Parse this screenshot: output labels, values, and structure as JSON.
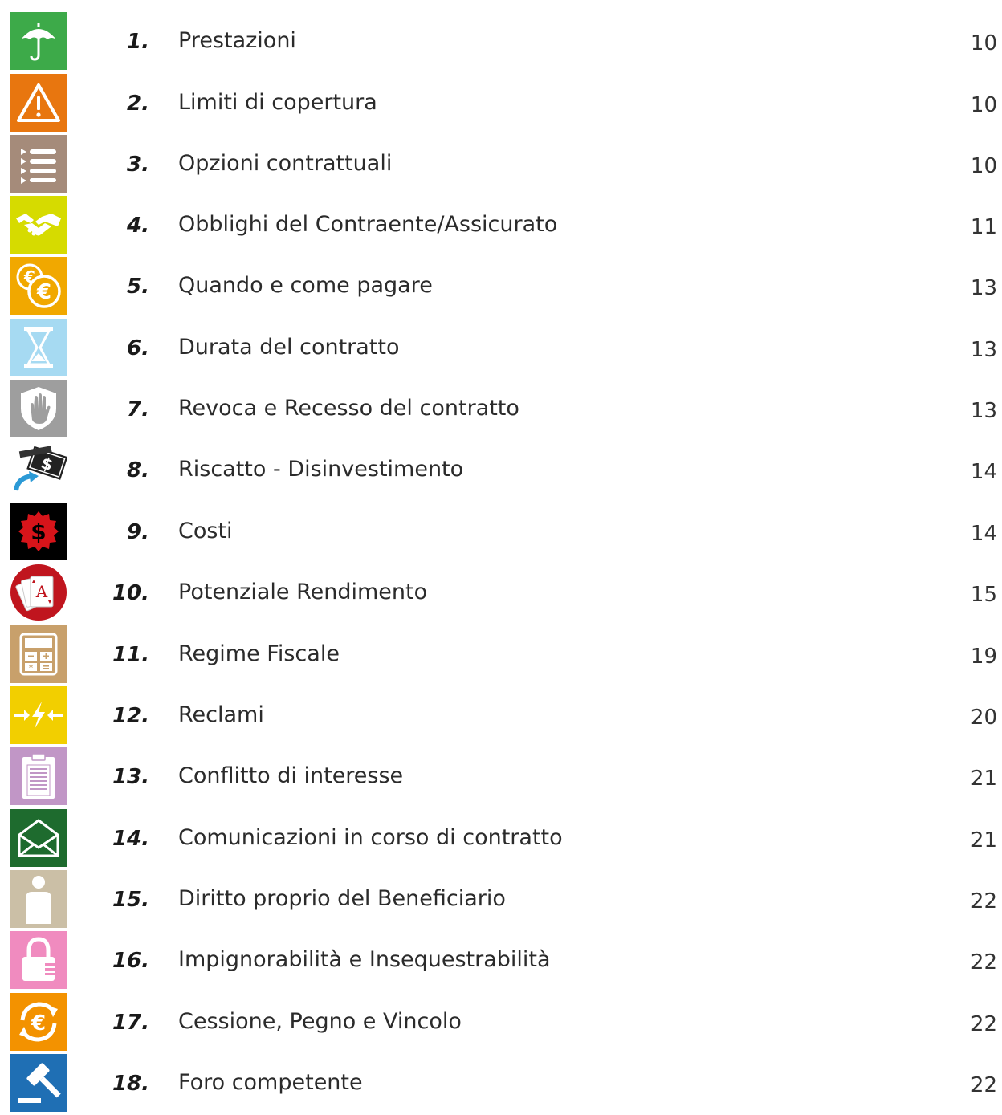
{
  "toc": [
    {
      "number": "1.",
      "title": "Prestazioni",
      "page": "10",
      "icon": "umbrella-icon",
      "color": "#3DAA49"
    },
    {
      "number": "2.",
      "title": "Limiti di copertura",
      "page": "10",
      "icon": "warning-icon",
      "color": "#E8760F"
    },
    {
      "number": "3.",
      "title": "Opzioni contrattuali",
      "page": "10",
      "icon": "list-icon",
      "color": "#A58B7A"
    },
    {
      "number": "4.",
      "title": "Obblighi del Contraente/Assicurato",
      "page": "11",
      "icon": "handshake-icon",
      "color": "#D6DB00"
    },
    {
      "number": "5.",
      "title": "Quando e come pagare",
      "page": "13",
      "icon": "euro-coins-icon",
      "color": "#F1A800"
    },
    {
      "number": "6.",
      "title": "Durata del contratto",
      "page": "13",
      "icon": "hourglass-icon",
      "color": "#A6DAF2"
    },
    {
      "number": "7.",
      "title": "Revoca e Recesso del contratto",
      "page": "13",
      "icon": "shield-hand-icon",
      "color": "#9E9E9E"
    },
    {
      "number": "8.",
      "title": "Riscatto - Disinvestimento",
      "page": "14",
      "icon": "money-return-icon",
      "color": "#FFFFFF"
    },
    {
      "number": "9.",
      "title": "Costi",
      "page": "14",
      "icon": "dollar-badge-icon",
      "color": "#000000"
    },
    {
      "number": "10.",
      "title": "Potenziale Rendimento",
      "page": "15",
      "icon": "playing-cards-icon",
      "color": "#C0151E"
    },
    {
      "number": "11.",
      "title": "Regime Fiscale",
      "page": "19",
      "icon": "calculator-icon",
      "color": "#C8A06B"
    },
    {
      "number": "12.",
      "title": "Reclami",
      "page": "20",
      "icon": "conflict-arrows-icon",
      "color": "#F2CF00"
    },
    {
      "number": "13.",
      "title": "Conflitto di interesse",
      "page": "21",
      "icon": "clipboard-icon",
      "color": "#C196C6"
    },
    {
      "number": "14.",
      "title": "Comunicazioni in corso di contratto",
      "page": "21",
      "icon": "envelope-icon",
      "color": "#1E6B2E"
    },
    {
      "number": "15.",
      "title": "Diritto proprio del Beneficiario",
      "page": "22",
      "icon": "person-icon",
      "color": "#CBBFA6"
    },
    {
      "number": "16.",
      "title": "Impignorabilità e Insequestrabilità",
      "page": "22",
      "icon": "padlock-icon",
      "color": "#F08BBF"
    },
    {
      "number": "17.",
      "title": "Cessione, Pegno e Vincolo",
      "page": "22",
      "icon": "euro-cycle-icon",
      "color": "#F39200"
    },
    {
      "number": "18.",
      "title": "Foro competente",
      "page": "22",
      "icon": "gavel-icon",
      "color": "#1F6FB4"
    }
  ]
}
